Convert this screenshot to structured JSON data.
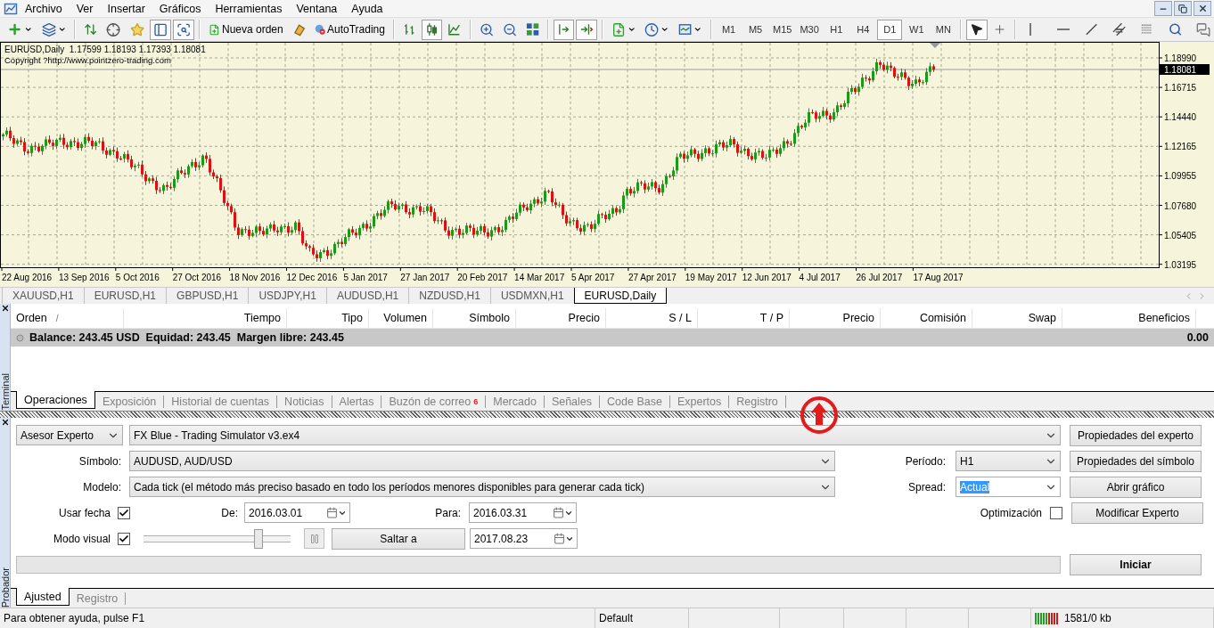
{
  "menu": {
    "items": [
      "Archivo",
      "Ver",
      "Insertar",
      "Gráficos",
      "Herramientas",
      "Ventana",
      "Ayuda"
    ]
  },
  "toolbar": {
    "left_tools": [
      {
        "selected": false
      },
      {
        "selected": false
      },
      {
        "selected": false
      },
      {
        "selected": false
      },
      {
        "selected": false
      },
      {
        "selected": true
      },
      {
        "selected": true
      }
    ],
    "text_buttons": [
      {
        "label": "Nueva orden"
      },
      {
        "label": "AutoTrading"
      }
    ],
    "chart_tools": [
      {
        "selected": false
      },
      {
        "selected": true
      },
      {
        "selected": false
      },
      {
        "selected": false
      },
      {
        "selected": false
      },
      {
        "selected": false
      },
      {
        "selected": true
      },
      {
        "selected": true
      },
      {
        "selected": false
      },
      {
        "selected": false
      },
      {
        "selected": false
      }
    ],
    "timeframes": [
      {
        "label": "M1",
        "selected": false
      },
      {
        "label": "M5",
        "selected": false
      },
      {
        "label": "M15",
        "selected": false
      },
      {
        "label": "M30",
        "selected": false
      },
      {
        "label": "H1",
        "selected": false
      },
      {
        "label": "H4",
        "selected": false
      },
      {
        "label": "D1",
        "selected": true
      },
      {
        "label": "W1",
        "selected": false
      },
      {
        "label": "MN",
        "selected": false
      }
    ],
    "drawing_tools": [
      {
        "selected": true
      },
      {
        "selected": false
      },
      {
        "selected": false
      },
      {
        "selected": false
      },
      {
        "selected": false
      },
      {
        "selected": false
      },
      {
        "selected": false
      },
      {
        "selected": false
      },
      {
        "selected": false
      }
    ]
  },
  "chart": {
    "header": "EURUSD,Daily  1.17599 1.18193 1.17393 1.18081",
    "copyright": "Copyright ?http://www.pointzero-trading.com",
    "price_labels": [
      "1.18990",
      "1.16715",
      "1.14440",
      "1.12165",
      "1.09955",
      "1.07680",
      "1.05405",
      "1.03195"
    ],
    "current_price": "1.18081",
    "date_labels": [
      "22 Aug 2016",
      "13 Sep 2016",
      "5 Oct 2016",
      "27 Oct 2016",
      "18 Nov 2016",
      "12 Dec 2016",
      "5 Jan 2017",
      "27 Jan 2017",
      "20 Feb 2017",
      "14 Mar 2017",
      "5 Apr 2017",
      "27 Apr 2017",
      "19 May 2017",
      "12 Jun 2017",
      "4 Jul 2017",
      "26 Jul 2017",
      "17 Aug 2017"
    ]
  },
  "chart_tabs": [
    {
      "label": "XAUUSD,H1",
      "selected": false
    },
    {
      "label": "EURUSD,H1",
      "selected": false
    },
    {
      "label": "GBPUSD,H1",
      "selected": false
    },
    {
      "label": "USDJPY,H1",
      "selected": false
    },
    {
      "label": "AUDUSD,H1",
      "selected": false
    },
    {
      "label": "NZDUSD,H1",
      "selected": false
    },
    {
      "label": "USDMXN,H1",
      "selected": false
    },
    {
      "label": "EURUSD,Daily",
      "selected": true
    }
  ],
  "terminal": {
    "title": "Terminal",
    "columns": [
      {
        "label": "Orden",
        "sort_mark": "/"
      },
      {
        "label": "Tiempo"
      },
      {
        "label": "Tipo"
      },
      {
        "label": "Volumen"
      },
      {
        "label": "Símbolo"
      },
      {
        "label": "Precio"
      },
      {
        "label": "S / L"
      },
      {
        "label": "T / P"
      },
      {
        "label": "Precio"
      },
      {
        "label": "Comisión"
      },
      {
        "label": "Swap"
      },
      {
        "label": "Beneficios"
      }
    ],
    "balance_row": {
      "text": "Balance: 243.45 USD  Equidad: 243.45  Margen libre: 243.45",
      "profit": "0.00"
    },
    "tabs": [
      {
        "label": "Operaciones",
        "selected": true
      },
      {
        "label": "Exposición",
        "selected": false
      },
      {
        "label": "Historial de cuentas",
        "selected": false
      },
      {
        "label": "Noticias",
        "selected": false
      },
      {
        "label": "Alertas",
        "selected": false
      },
      {
        "label": "Buzón de correo",
        "selected": false,
        "badge": "6"
      },
      {
        "label": "Mercado",
        "selected": false
      },
      {
        "label": "Señales",
        "selected": false
      },
      {
        "label": "Code Base",
        "selected": false
      },
      {
        "label": "Expertos",
        "selected": false
      },
      {
        "label": "Registro",
        "selected": false
      }
    ]
  },
  "tester": {
    "title": "Probador",
    "type_select": "Asesor Experto",
    "expert_select": "FX Blue - Trading Simulator v3.ex4",
    "symbol": {
      "label": "Símbolo:",
      "value": "AUDUSD, AUD/USD"
    },
    "model": {
      "label": "Modelo:",
      "value": "Cada tick (el método más preciso basado en todo los períodos menores disponibles para generar cada tick)"
    },
    "period": {
      "label": "Período:",
      "value": "H1"
    },
    "spread": {
      "label": "Spread:",
      "value": "Actual",
      "text_selected": true
    },
    "use_date": {
      "label": "Usar fecha",
      "checked": true
    },
    "from": {
      "label": "De:",
      "value": "2016.03.01"
    },
    "to": {
      "label": "Para:",
      "value": "2016.03.31"
    },
    "optimization": {
      "label": "Optimización",
      "checked": false
    },
    "visual_mode": {
      "label": "Modo visual",
      "checked": true
    },
    "speed": {
      "level": 0.8
    },
    "skip_button": "Saltar a",
    "skip_date": "2017.08.23",
    "progress": {
      "level": 0
    },
    "buttons": [
      "Propiedades del experto",
      "Propiedades del símbolo",
      "Abrir gráfico",
      "Modificar Experto"
    ],
    "start_button": "Iniciar",
    "tabs": [
      {
        "label": "Ajusted",
        "selected": true
      },
      {
        "label": "Registro",
        "selected": false
      }
    ]
  },
  "status_bar": {
    "help": "Para obtener ayuda, pulse F1",
    "profile": "Default",
    "traffic": "1581/0 kb"
  }
}
